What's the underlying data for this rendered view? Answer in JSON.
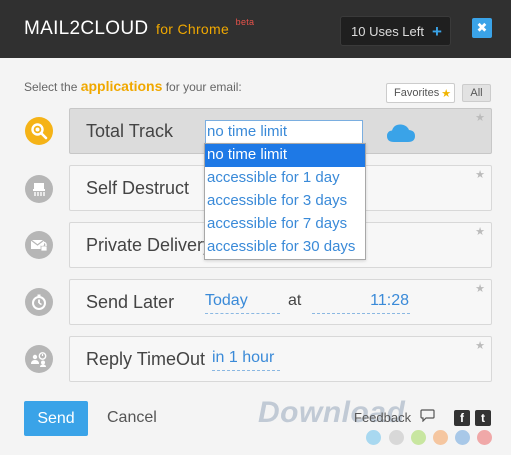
{
  "header": {
    "brand": "MAIL2CLOUD",
    "brand_for": "for Chrome",
    "brand_beta": "beta",
    "uses_left": "10 Uses Left",
    "plus": "+",
    "close": "✖"
  },
  "prompt": {
    "before": "Select the ",
    "highlight": "applications",
    "after": " for your email:"
  },
  "filters": {
    "favorites": "Favorites",
    "all": "All"
  },
  "apps": [
    {
      "title": "Total Track",
      "icon": "magnifier-icon",
      "value": "no time limit"
    },
    {
      "title": "Self Destruct",
      "icon": "shredder-icon"
    },
    {
      "title": "Private Delivery",
      "icon": "private-mail-icon"
    },
    {
      "title": "Send Later",
      "icon": "stopwatch-icon",
      "date": "Today",
      "at": "at",
      "time": "11:28"
    },
    {
      "title": "Reply TimeOut",
      "icon": "people-clock-icon",
      "value": "in 1 hour"
    }
  ],
  "dropdown": {
    "options": [
      "no time limit",
      "accessible for 1 day",
      "accessible for 3 days",
      "accessible for 7 days",
      "accessible for 30 days"
    ],
    "selected": "no time limit"
  },
  "footer": {
    "send": "Send",
    "cancel": "Cancel",
    "feedback": "Feedback",
    "facebook": "f",
    "twitter": "t"
  },
  "watermark": "Download",
  "colors": {
    "accent": "#3aa3e8",
    "brand_orange": "#f0a800",
    "header_bg": "#303030",
    "dropdown_selected": "#1e79e6",
    "dots": [
      "#a8d8f0",
      "#d8d8d8",
      "#c8e6a0",
      "#f5c6a0",
      "#a8c8e8",
      "#f0a8a8"
    ]
  }
}
